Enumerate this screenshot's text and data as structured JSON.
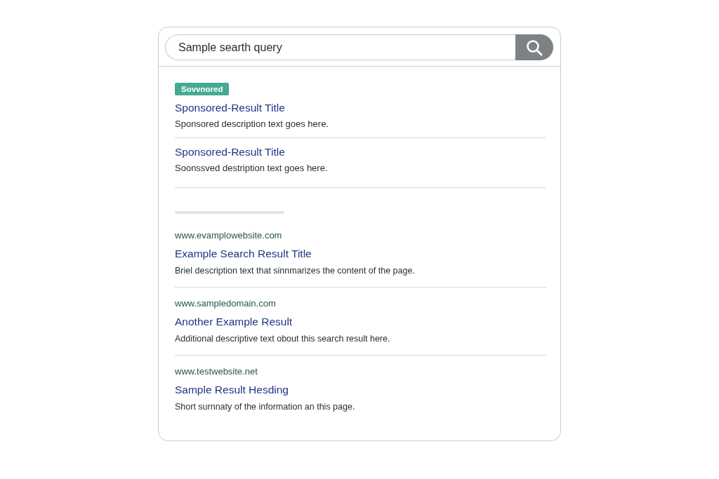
{
  "search": {
    "query": "Sample searth query"
  },
  "sponsored": {
    "badge": "Sovvnored",
    "results": [
      {
        "title": "Sponsored-Result Title",
        "description": "Sponsored description text goes here."
      },
      {
        "title": "Sponsored-Result Title",
        "description": "Soonssved destription text goes here."
      }
    ]
  },
  "results": [
    {
      "url": "www.evamplowebsite.com",
      "title": "Example Search Result Title",
      "description": "Briel description text that sinnmarizes the content of the page."
    },
    {
      "url": "www.sampledomain.com",
      "title": "Another Example Result",
      "description": "Additional descriptive text obout this search result here."
    },
    {
      "url": "www.testwebsite.net",
      "title": "Sample Result Hesding",
      "description": "Short surnnaty of the information an this page."
    }
  ]
}
